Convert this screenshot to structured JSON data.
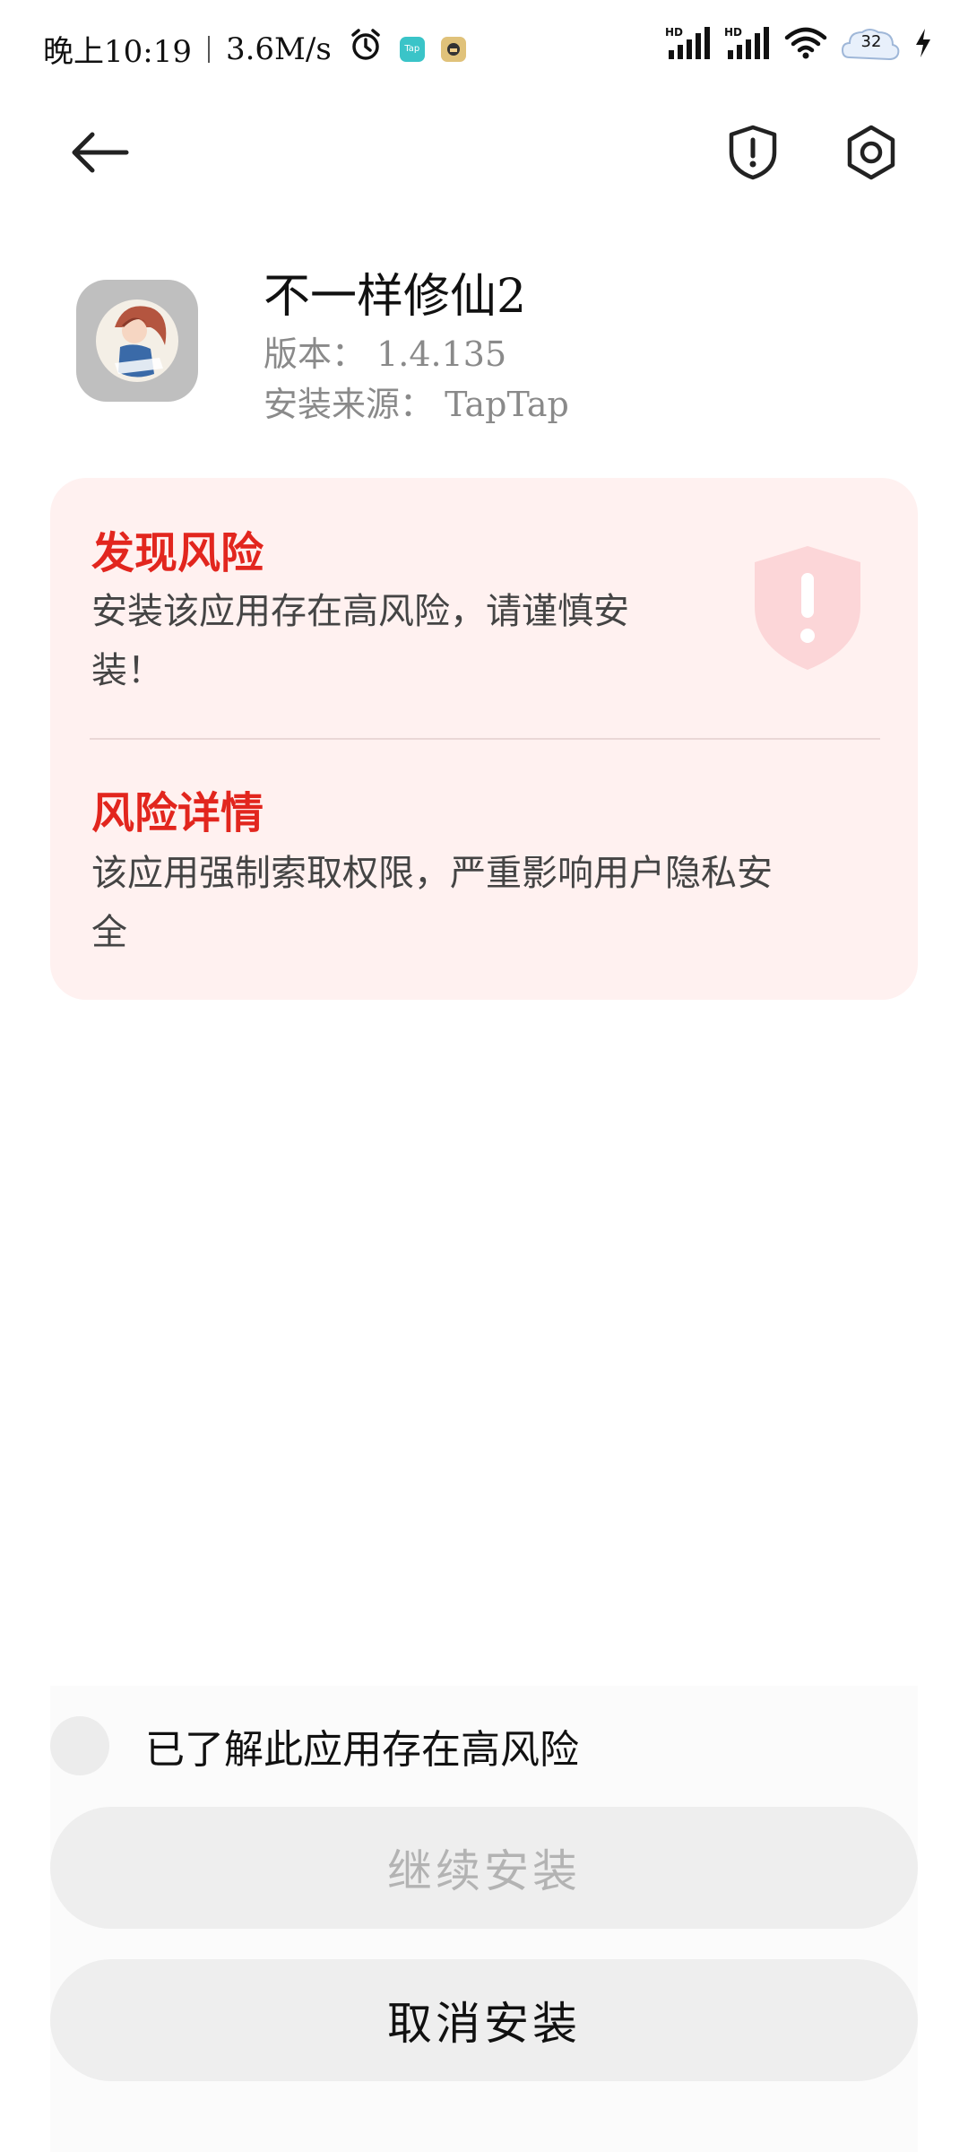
{
  "status_bar": {
    "time": "晚上10:19",
    "speed": "3.6M/s",
    "battery": "32",
    "icons": [
      "alarm-icon",
      "taptap-notif-icon",
      "app-notif-icon",
      "hd-signal-icon",
      "hd-signal-icon",
      "wifi-icon",
      "battery-icon",
      "charging-icon"
    ]
  },
  "toolbar": {
    "back_icon": "arrow-left-icon",
    "security_icon": "shield-alert-icon",
    "settings_icon": "gear-icon"
  },
  "app": {
    "name": "不一样修仙2",
    "version": "版本： 1.4.135",
    "source": "安装来源： TapTap"
  },
  "risk": {
    "found_title": "发现风险",
    "found_text_line1": "安装该应用存在高风险，请谨慎安",
    "found_text_line2": "装！",
    "detail_title": "风险详情",
    "detail_text_line1": "该应用强制索取权限，严重影响用户隐私安",
    "detail_text_line2": "全",
    "accent_color": "#e2261e",
    "card_color": "#fff1f0"
  },
  "actions": {
    "acknowledge_label": "已了解此应用存在高风险",
    "acknowledged": false,
    "continue_label": "继续安装",
    "cancel_label": "取消安装"
  }
}
